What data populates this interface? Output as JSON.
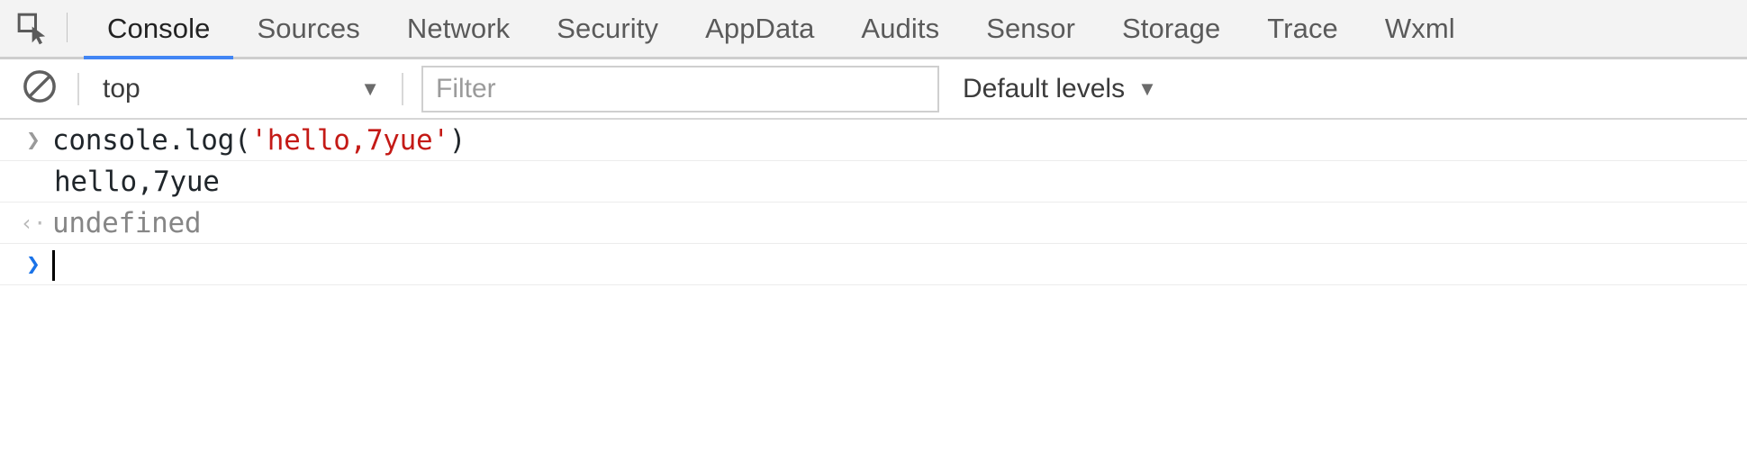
{
  "tabbar": {
    "inspect_icon": "inspect-element-icon",
    "tabs": [
      {
        "label": "Console",
        "active": true
      },
      {
        "label": "Sources",
        "active": false
      },
      {
        "label": "Network",
        "active": false
      },
      {
        "label": "Security",
        "active": false
      },
      {
        "label": "AppData",
        "active": false
      },
      {
        "label": "Audits",
        "active": false
      },
      {
        "label": "Sensor",
        "active": false
      },
      {
        "label": "Storage",
        "active": false
      },
      {
        "label": "Trace",
        "active": false
      },
      {
        "label": "Wxml",
        "active": false
      }
    ],
    "active_underline_color": "#4285f4",
    "background_color": "#f3f3f3"
  },
  "toolbar": {
    "clear_icon": "clear-console-icon",
    "context": {
      "value": "top",
      "caret_icon": "chevron-down-icon"
    },
    "filter": {
      "value": "",
      "placeholder": "Filter"
    },
    "levels": {
      "label": "Default levels",
      "caret_icon": "chevron-down-icon"
    }
  },
  "console": {
    "rows": [
      {
        "type": "input",
        "marker": "❯",
        "segments": [
          {
            "text": "console.log(",
            "kind": "plain"
          },
          {
            "text": "'hello,7yue'",
            "kind": "string"
          },
          {
            "text": ")",
            "kind": "plain"
          }
        ],
        "full_text": "console.log('hello,7yue')"
      },
      {
        "type": "output",
        "marker": "",
        "full_text": "hello,7yue"
      },
      {
        "type": "return",
        "marker": "‹·",
        "full_text": "undefined"
      },
      {
        "type": "prompt",
        "marker": "❯",
        "full_text": ""
      }
    ],
    "string_color": "#c41a16",
    "prompt_color": "#1a73e8",
    "return_text_color": "#868686"
  }
}
